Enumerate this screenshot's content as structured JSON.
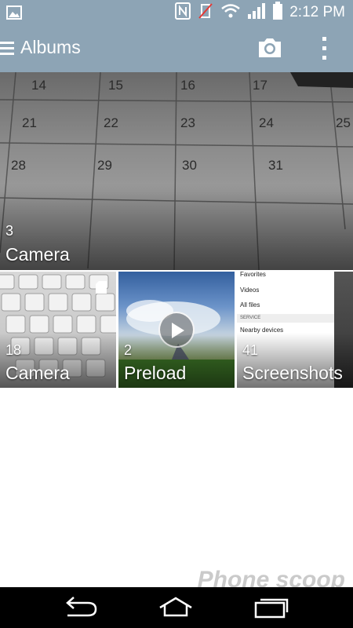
{
  "status_bar": {
    "time": "2:12 PM",
    "icons": [
      "gallery-notification-icon",
      "nfc-icon",
      "vibrate-off-icon",
      "wifi-icon",
      "signal-icon",
      "battery-icon"
    ]
  },
  "action_bar": {
    "title": "Albums",
    "icons": [
      "menu-icon",
      "camera-icon",
      "overflow-menu-icon"
    ]
  },
  "albums": [
    {
      "name": "Camera",
      "count": "3"
    },
    {
      "name": "Camera",
      "count": "18"
    },
    {
      "name": "Preload",
      "count": "2"
    },
    {
      "name": "Screenshots",
      "count": "41"
    }
  ],
  "screenshot_preview": {
    "items": [
      "Favorites",
      "Videos",
      "All files"
    ],
    "section": "SERVICE",
    "section_item": "Nearby devices"
  },
  "watermark": "Phone scoop",
  "nav_bar": {
    "icons": [
      "back-icon",
      "home-icon",
      "recents-icon"
    ]
  },
  "colors": {
    "action_bar": "#8da4b5",
    "nav_bar": "#000000"
  }
}
